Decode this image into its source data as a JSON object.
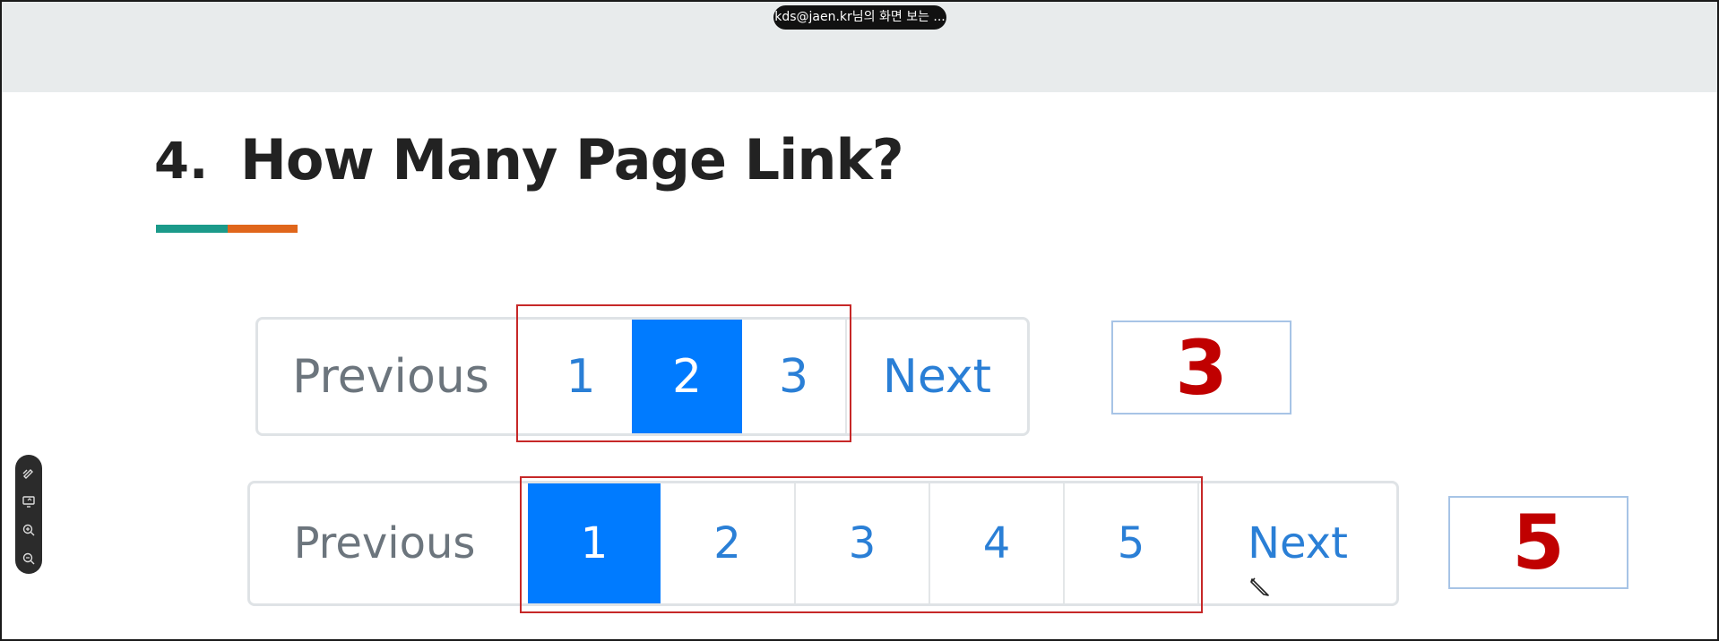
{
  "share_banner": {
    "label": "kds@jaen.kr님의 화면 보는 ..."
  },
  "slide": {
    "number": "4.",
    "title": "How Many Page Link?",
    "accent_colors": [
      "#1b9a8a",
      "#e0661b"
    ]
  },
  "pagination_1": {
    "previous_label": "Previous",
    "pages": [
      "1",
      "2",
      "3"
    ],
    "active_page": "2",
    "next_label": "Next",
    "answer": "3"
  },
  "pagination_2": {
    "previous_label": "Previous",
    "pages": [
      "1",
      "2",
      "3",
      "4",
      "5"
    ],
    "active_page": "1",
    "next_label": "Next",
    "answer": "5"
  },
  "toolbar": {
    "icons": [
      "pen-icon",
      "screen-share-icon",
      "zoom-in-icon",
      "zoom-out-icon"
    ]
  },
  "colors": {
    "active_page": "#007bff",
    "link": "#2a7fd6",
    "highlight_border": "#c62828",
    "answer_text": "#c00000"
  }
}
